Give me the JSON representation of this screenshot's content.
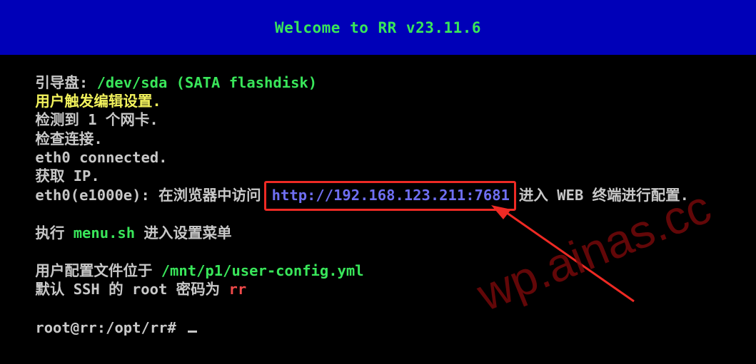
{
  "title_bar": {
    "text": "Welcome to RR v23.11.6",
    "background": "#0000b8",
    "text_color": "#39e65a"
  },
  "console": {
    "line1": {
      "label": "引导盘: ",
      "value": "/dev/sda (SATA flashdisk)"
    },
    "line2": {
      "text": "用户触发编辑设置."
    },
    "line3": {
      "text": "检测到 1 个网卡."
    },
    "line4": {
      "text": "检查连接."
    },
    "line5": {
      "text": "eth0 connected."
    },
    "line6": {
      "text": "获取 IP."
    },
    "line7": {
      "prefix": "eth0(e1000e): 在浏览器中访问",
      "url": "http://192.168.123.211:7681",
      "suffix": "进入 WEB 终端进行配置."
    },
    "line8": {
      "prefix": "执行 ",
      "command": "menu.sh",
      "suffix": " 进入设置菜单"
    },
    "line9": {
      "prefix": "用户配置文件位于 ",
      "path": "/mnt/p1/user-config.yml"
    },
    "line10": {
      "prefix": "默认 SSH 的 root 密码为 ",
      "password": "rr"
    },
    "prompt": {
      "text": "root@rr:/opt/rr# "
    }
  },
  "annotation": {
    "highlight_color": "#ee2a24",
    "arrow_color": "#ee2a24"
  },
  "watermark": {
    "text": "wp.ainas.cc",
    "color": "#78080a"
  },
  "colors": {
    "terminal_bg": "#000000",
    "text_white": "#c8c8c8",
    "text_green": "#39e65a",
    "text_yellow": "#f2f25c",
    "text_red": "#f04a4a",
    "text_blue": "#6f6ff2"
  }
}
